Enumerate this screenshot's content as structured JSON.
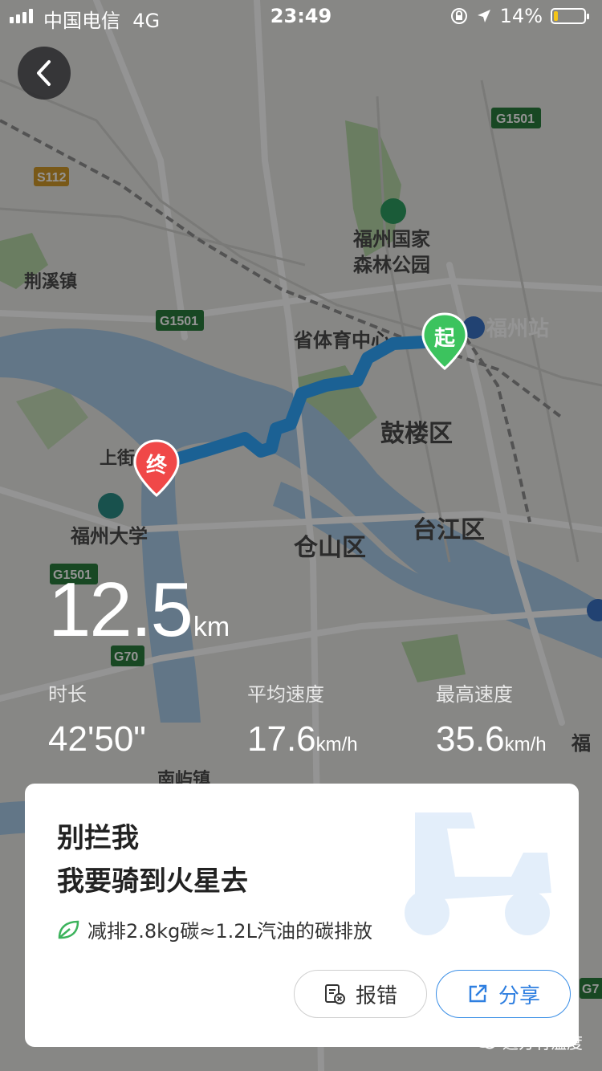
{
  "status_bar": {
    "carrier": "中国电信",
    "network": "4G",
    "time": "23:49",
    "battery": "14%",
    "battery_level": 0.14
  },
  "map": {
    "labels": {
      "forest_park_line1": "福州国家",
      "forest_park_line2": "森林公园",
      "jingxi": "荆溪镇",
      "sports_center": "省体育中心",
      "fuzhou_station": "福州站",
      "gulou": "鼓楼区",
      "taijiang": "台江区",
      "cangshan": "仓山区",
      "fuzhou_university": "福州大学",
      "shangjie": "上街",
      "nanyu": "南屿镇",
      "fu_edge": "福"
    },
    "road_shields": {
      "g1501_top": "G1501",
      "g1501_mid": "G1501",
      "g1501_low": "G1501",
      "s112": "S112",
      "g70": "G70",
      "g7_edge": "G7"
    },
    "start_marker": "起",
    "end_marker": "终"
  },
  "stats": {
    "distance_value": "12.5",
    "distance_unit": "km",
    "duration_label": "时长",
    "duration_value": "42'50\"",
    "avg_speed_label": "平均速度",
    "avg_speed_value": "17.6",
    "avg_speed_unit": "km/h",
    "max_speed_label": "最高速度",
    "max_speed_value": "35.6",
    "max_speed_unit": "km/h"
  },
  "card": {
    "title_line1": "别拦我",
    "title_line2": "我要骑到火星去",
    "carbon_text": "减排2.8kg碳≈1.2L汽油的碳排放",
    "report_label": "报错",
    "share_label": "分享"
  },
  "watermark": "远方有温度",
  "colors": {
    "route": "#2fa8ff",
    "start_marker": "#3cc35e",
    "end_marker": "#f04848",
    "share_accent": "#2f7fe0",
    "leaf": "#3cb35c"
  }
}
